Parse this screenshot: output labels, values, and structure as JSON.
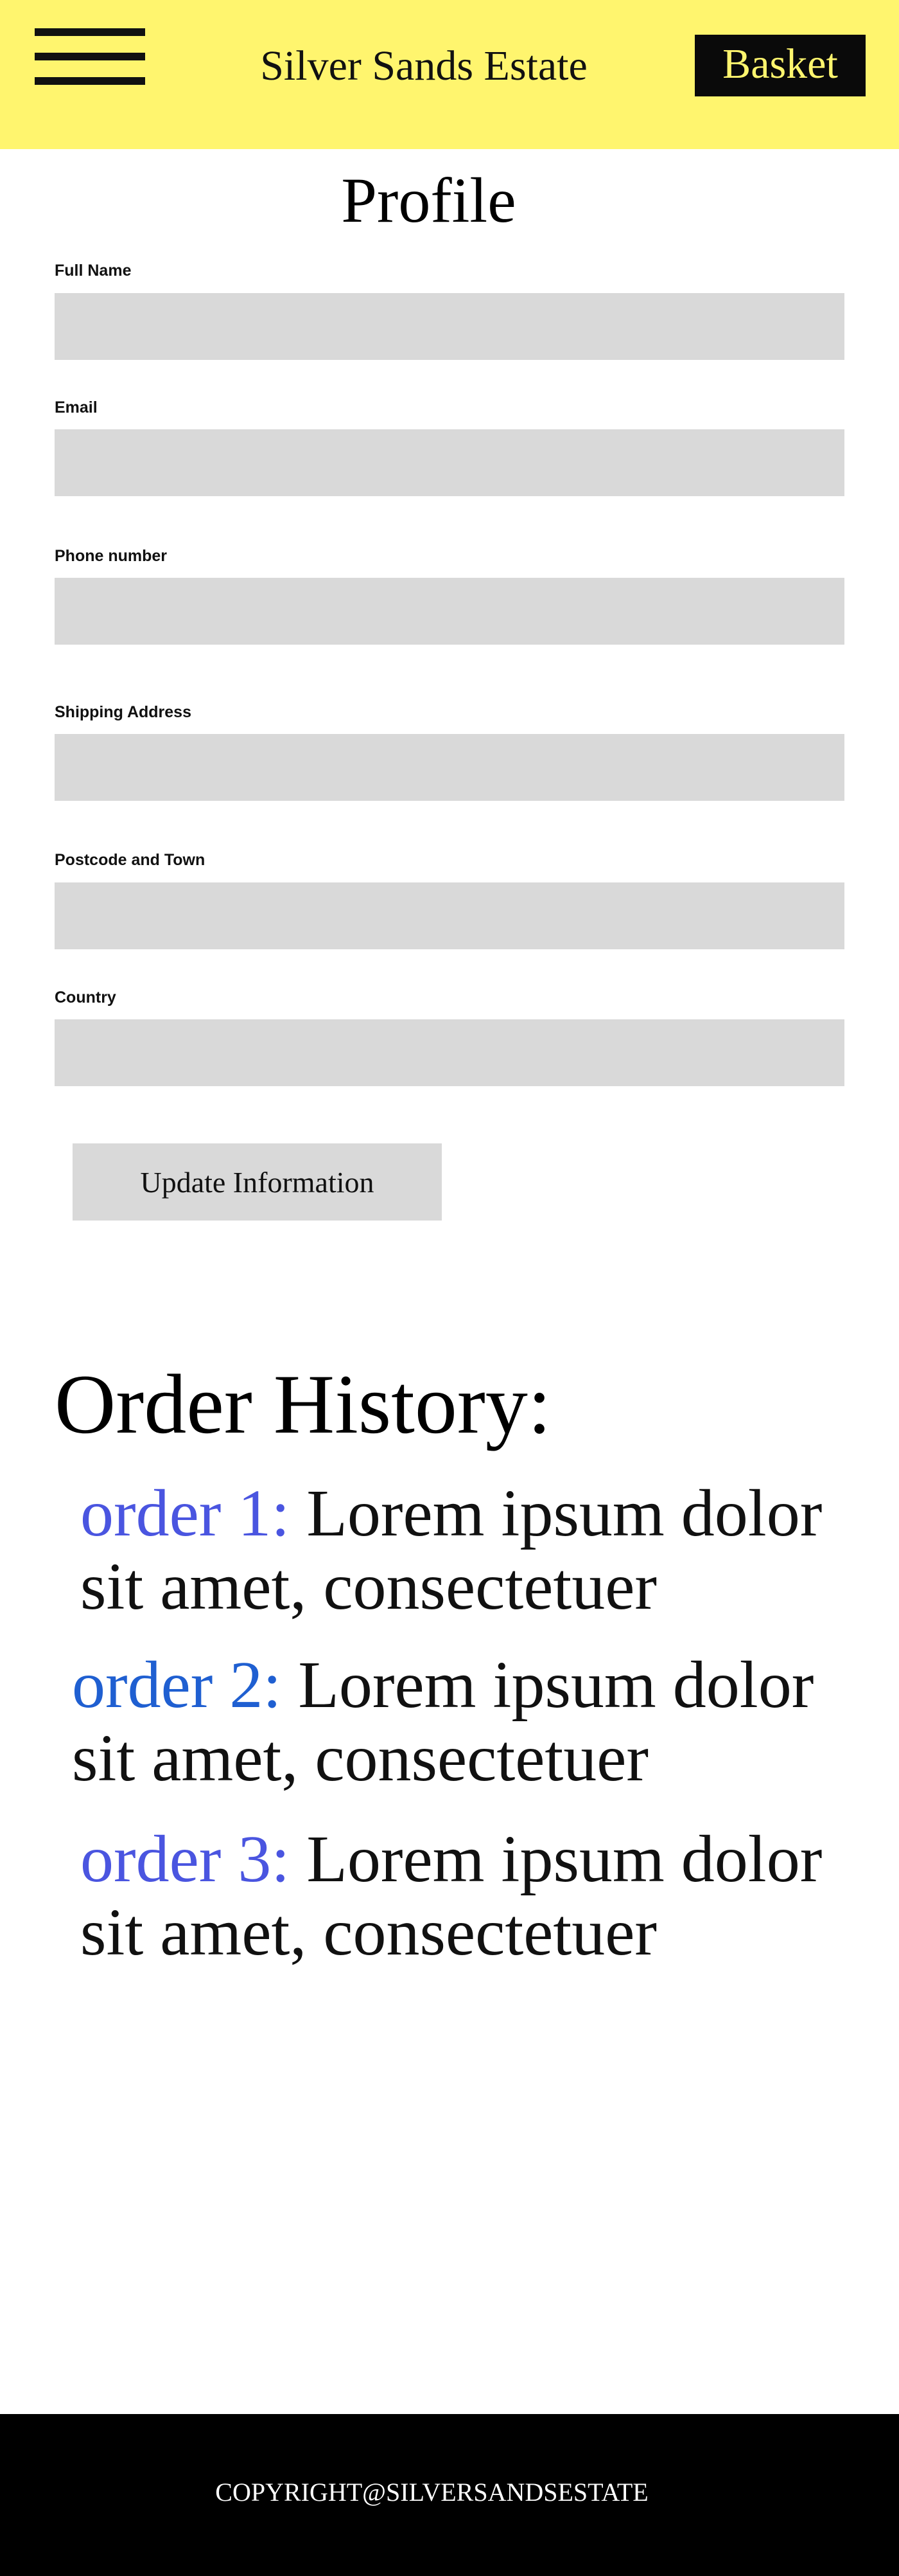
{
  "header": {
    "menu_icon": "hamburger-menu-icon",
    "brand": "Silver Sands Estate",
    "basket_label": "Basket",
    "background_color": "#fff56e",
    "basket_text_color": "#fff56e"
  },
  "profile": {
    "title": "Profile",
    "fields": [
      {
        "label": "Full Name",
        "value": ""
      },
      {
        "label": "Email",
        "value": ""
      },
      {
        "label": "Phone number",
        "value": ""
      },
      {
        "label": "Shipping Address",
        "value": ""
      },
      {
        "label": "Postcode and Town",
        "value": ""
      },
      {
        "label": "Country",
        "value": ""
      }
    ],
    "update_label": "Update Information"
  },
  "order_history": {
    "title": "Order History:",
    "orders": [
      {
        "label": "order 1:",
        "text": "Lorem ipsum dolor sit amet, consectetuer"
      },
      {
        "label": "order 2:",
        "text": "Lorem ipsum dolor sit amet, consectetuer"
      },
      {
        "label": "order 3:",
        "text": "Lorem ipsum dolor sit amet, consectetuer"
      }
    ],
    "label_colors": [
      "#4a55e0",
      "#1f5fd1",
      "#4a55e0"
    ]
  },
  "footer": {
    "copyright": "COPYRIGHT@SILVERSANDSESTATE"
  }
}
